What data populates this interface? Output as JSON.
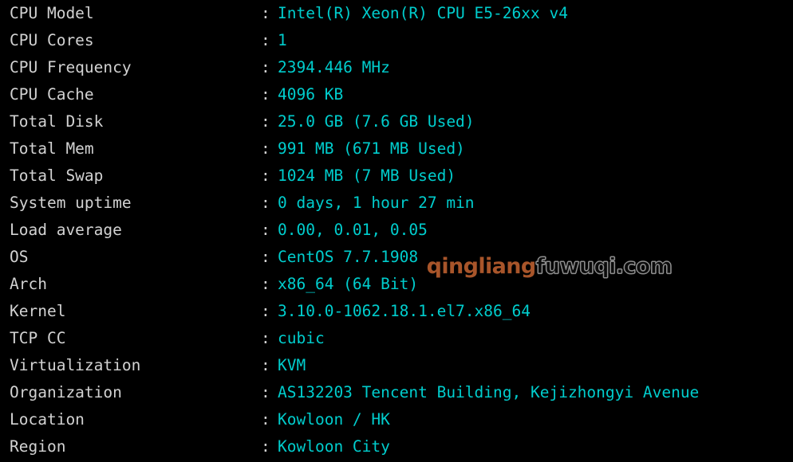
{
  "terminal": {
    "background_color": "#000000",
    "label_color": "#d2d2d2",
    "value_color": "#00cdcd",
    "separator": ":",
    "rows": [
      {
        "label": "CPU Model",
        "value": "Intel(R) Xeon(R) CPU E5-26xx v4"
      },
      {
        "label": "CPU Cores",
        "value": "1"
      },
      {
        "label": "CPU Frequency",
        "value": "2394.446 MHz"
      },
      {
        "label": "CPU Cache",
        "value": "4096 KB"
      },
      {
        "label": "Total Disk",
        "value": "25.0 GB (7.6 GB Used)"
      },
      {
        "label": "Total Mem",
        "value": "991 MB (671 MB Used)"
      },
      {
        "label": "Total Swap",
        "value": "1024 MB (7 MB Used)"
      },
      {
        "label": "System uptime",
        "value": "0 days, 1 hour 27 min"
      },
      {
        "label": "Load average",
        "value": "0.00, 0.01, 0.05"
      },
      {
        "label": "OS",
        "value": "CentOS 7.7.1908"
      },
      {
        "label": "Arch",
        "value": "x86_64 (64 Bit)"
      },
      {
        "label": "Kernel",
        "value": "3.10.0-1062.18.1.el7.x86_64"
      },
      {
        "label": "TCP CC",
        "value": "cubic"
      },
      {
        "label": "Virtualization",
        "value": "KVM"
      },
      {
        "label": "Organization",
        "value": "AS132203 Tencent Building, Kejizhongyi Avenue"
      },
      {
        "label": "Location",
        "value": "Kowloon / HK"
      },
      {
        "label": "Region",
        "value": "Kowloon City"
      }
    ]
  },
  "watermark": {
    "brand_text": "qingliang",
    "domain_text": "fuwuqi.com",
    "brand_color": "#a8552a",
    "domain_outline_color": "#8f8f8f"
  }
}
